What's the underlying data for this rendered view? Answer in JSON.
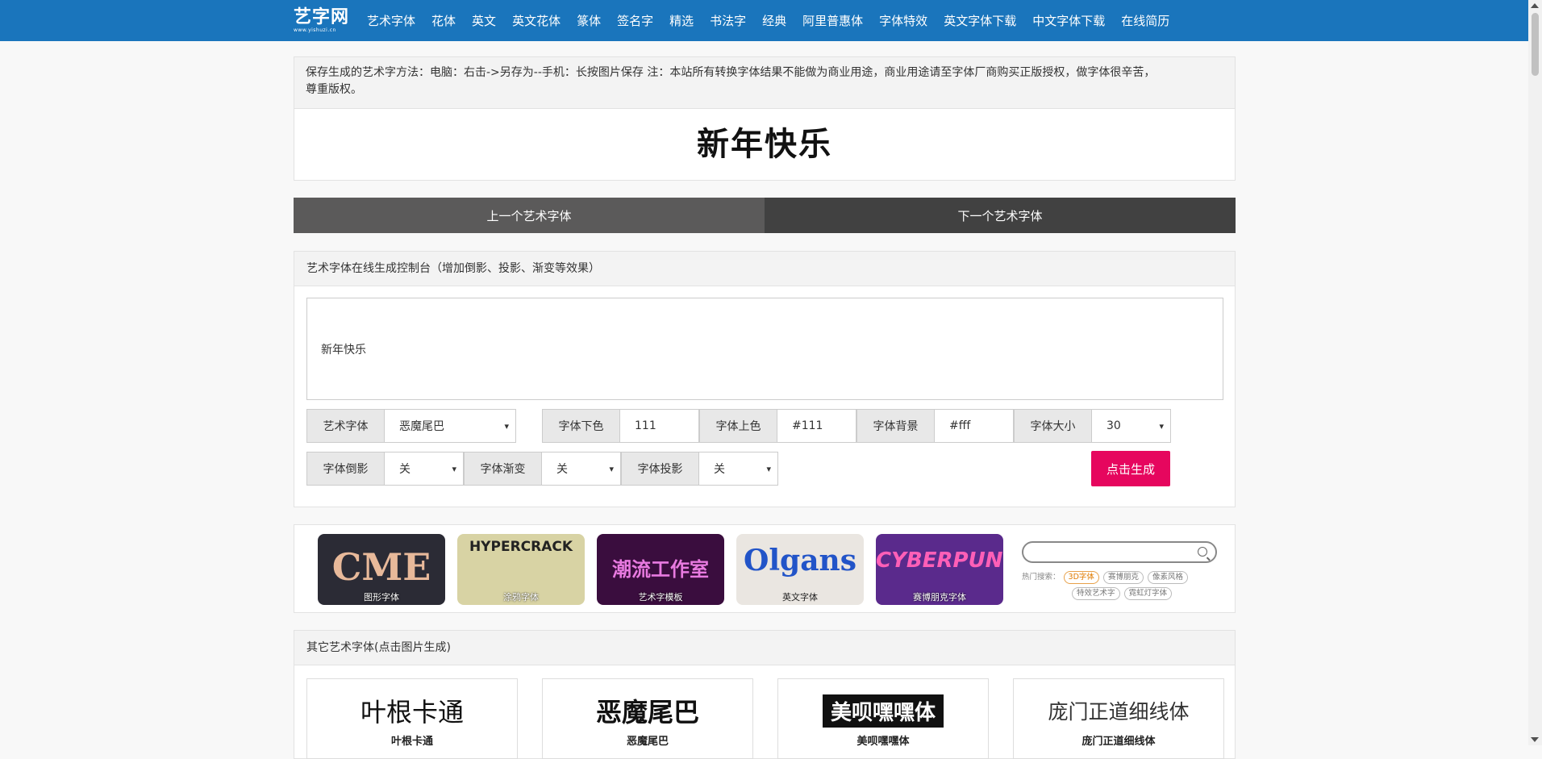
{
  "logo": {
    "main": "艺字网",
    "sub": "www.yishuzi.cn"
  },
  "nav": [
    "艺术字体",
    "花体",
    "英文",
    "英文花体",
    "篆体",
    "签名字",
    "精选",
    "书法字",
    "经典",
    "阿里普惠体",
    "字体特效",
    "英文字体下载",
    "中文字体下载",
    "在线简历"
  ],
  "notice": {
    "line1": "保存生成的艺术字方法：电脑：右击->另存为--手机：长按图片保存 注：本站所有转换字体结果不能做为商业用途，商业用途请至字体厂商购买正版授权，做字体很辛苦，",
    "line2": "尊重版权。",
    "preview": "新年快乐"
  },
  "pager": {
    "prev": "上一个艺术字体",
    "next": "下一个艺术字体"
  },
  "console": {
    "title": "艺术字体在线生成控制台（增加倒影、投影、渐变等效果）",
    "text": "新年快乐",
    "font_label": "艺术字体",
    "font_value": "恶魔尾巴",
    "bottom_color_label": "字体下色",
    "bottom_color_value": "111",
    "top_color_label": "字体上色",
    "top_color_value": "#111",
    "bg_label": "字体背景",
    "bg_value": "#fff",
    "size_label": "字体大小",
    "size_value": "30",
    "reflect_label": "字体倒影",
    "reflect_value": "关",
    "gradient_label": "字体渐变",
    "gradient_value": "关",
    "shadow_label": "字体投影",
    "shadow_value": "关",
    "generate": "点击生成"
  },
  "banner": {
    "items": [
      {
        "caption": "图形字体",
        "art": "CME"
      },
      {
        "caption": "涂鸦字体",
        "art": "HYPERCRACK"
      },
      {
        "caption": "艺术字模板",
        "art": "潮流工作室"
      },
      {
        "caption": "英文字体",
        "art": "Olgans"
      },
      {
        "caption": "赛博朋克字体",
        "art": "CYBERPUNK"
      }
    ],
    "hot_label": "热门搜索：",
    "tags": [
      "3D字体",
      "赛博朋克",
      "像素风格",
      "特效艺术字",
      "霓虹灯字体"
    ]
  },
  "others": {
    "title": "其它艺术字体(点击图片生成)",
    "cards": [
      {
        "sample": "叶根卡通",
        "name": "叶根卡通"
      },
      {
        "sample": "恶魔尾巴",
        "name": "恶魔尾巴"
      },
      {
        "sample": "美呗嘿嘿体",
        "name": "美呗嘿嘿体"
      },
      {
        "sample": "庞门正道细线体",
        "name": "庞门正道细线体"
      }
    ]
  }
}
